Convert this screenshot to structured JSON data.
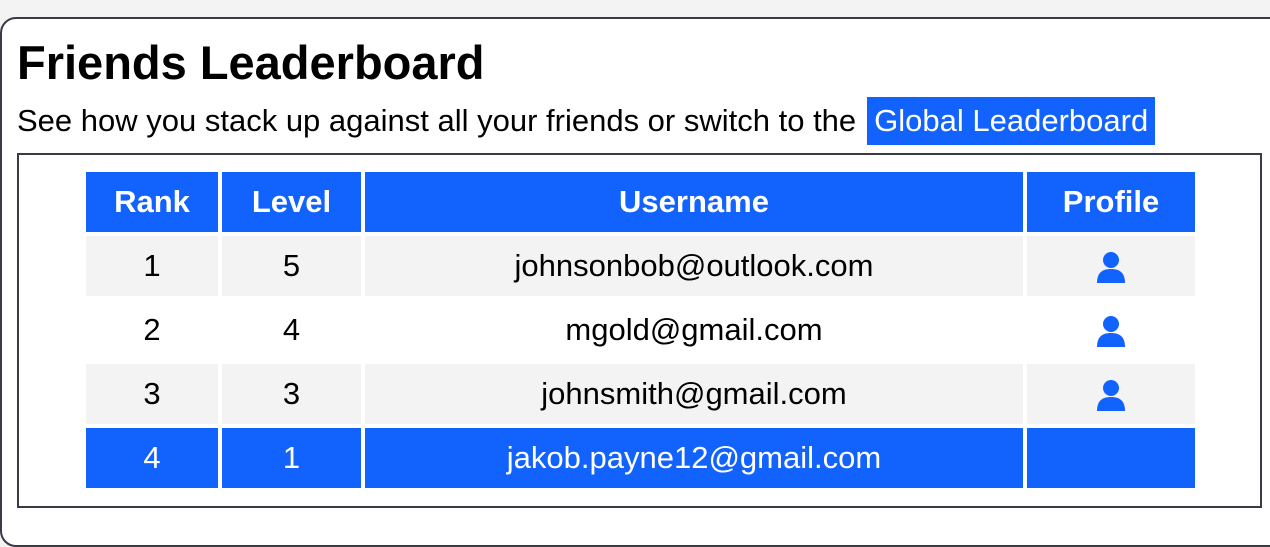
{
  "header": {
    "title": "Friends Leaderboard",
    "subtitle": "See how you stack up against all your friends or switch to the",
    "global_link_label": "Global Leaderboard"
  },
  "table": {
    "columns": {
      "rank": "Rank",
      "level": "Level",
      "username": "Username",
      "profile": "Profile"
    },
    "rows": [
      {
        "rank": "1",
        "level": "5",
        "username": "johnsonbob@outlook.com",
        "profile_icon": "user-icon"
      },
      {
        "rank": "2",
        "level": "4",
        "username": "mgold@gmail.com",
        "profile_icon": "user-icon"
      },
      {
        "rank": "3",
        "level": "3",
        "username": "johnsmith@gmail.com",
        "profile_icon": "user-icon"
      },
      {
        "rank": "4",
        "level": "1",
        "username": "jakob.payne12@gmail.com",
        "highlighted": true
      }
    ]
  },
  "colors": {
    "accent": "#1262fe",
    "row_alt": "#f3f3f3",
    "border": "#3a3a48"
  }
}
